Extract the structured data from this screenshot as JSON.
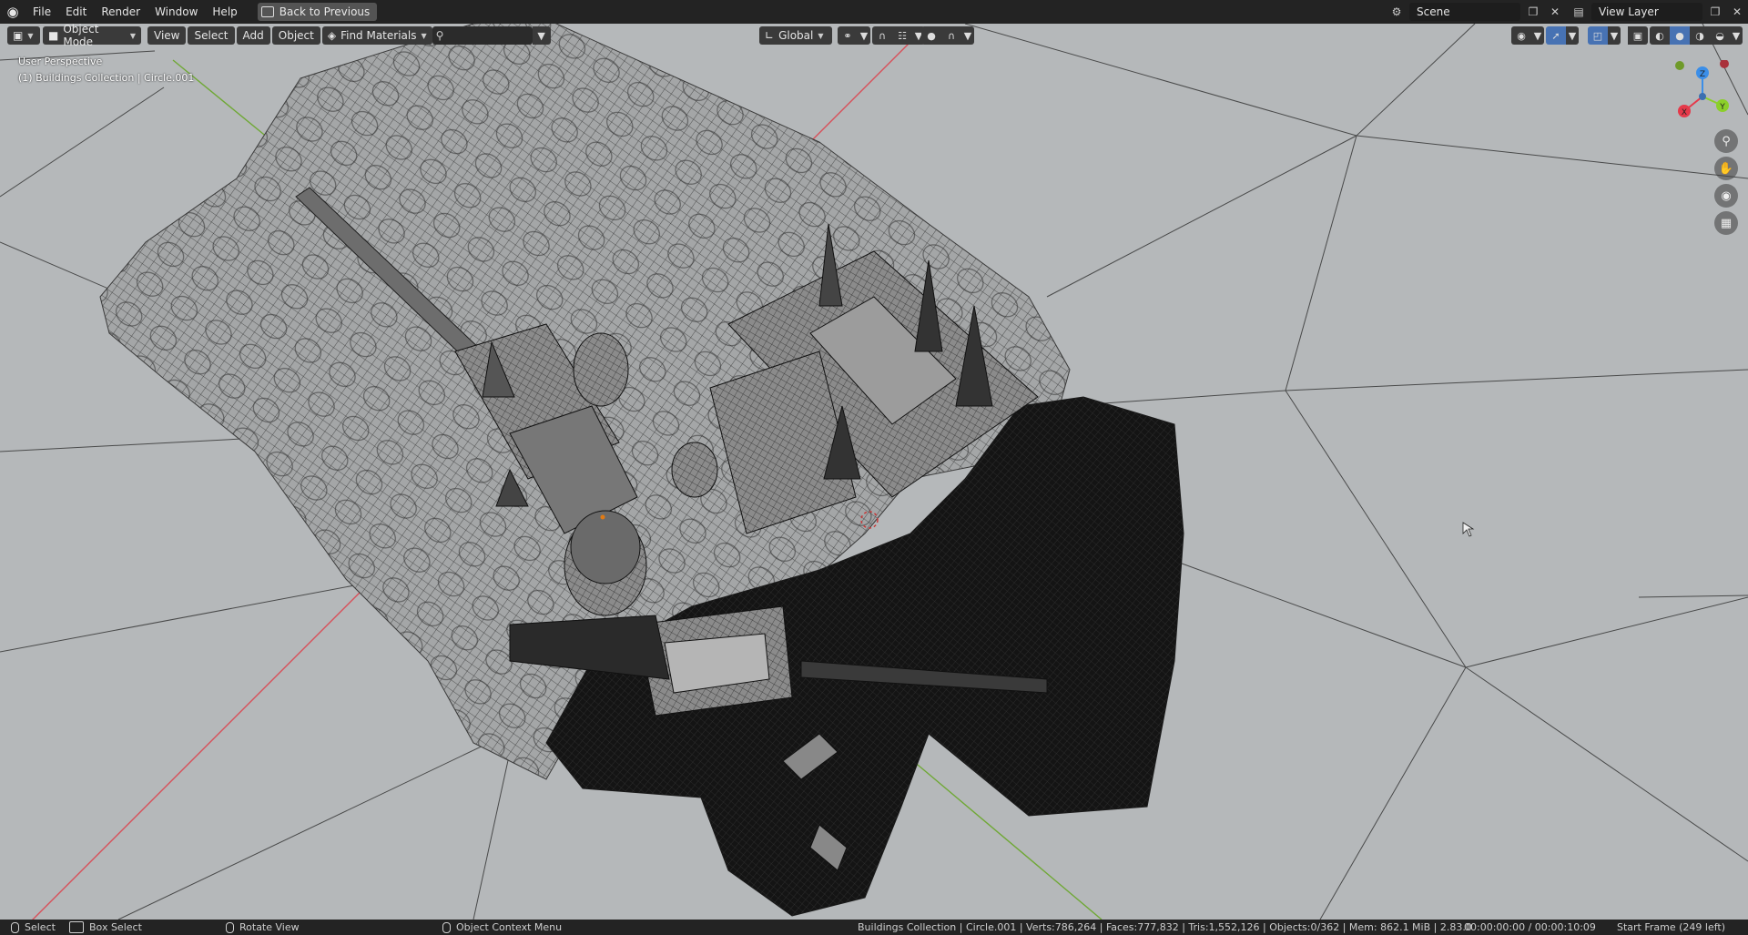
{
  "menu": {
    "items": [
      "File",
      "Edit",
      "Render",
      "Window",
      "Help"
    ],
    "back_button": "Back to Previous"
  },
  "topright": {
    "scene": "Scene",
    "view_layer": "View Layer"
  },
  "viewport_header": {
    "mode": "Object Mode",
    "view": "View",
    "select": "Select",
    "add": "Add",
    "object": "Object",
    "find_materials": "Find Materials",
    "transform_orientation": "Global"
  },
  "viewport": {
    "perspective": "User Perspective",
    "collection_info": "(1) Buildings Collection | Circle.001"
  },
  "gizmo": {
    "x": "X",
    "y": "Y",
    "z": "Z",
    "colors": {
      "x": "#e5394a",
      "y": "#8bcf2a",
      "z": "#3b8ee8"
    }
  },
  "statusbar": {
    "select": "Select",
    "box_select": "Box Select",
    "rotate_view": "Rotate View",
    "context_menu": "Object Context Menu",
    "stats": "Buildings Collection | Circle.001 | Verts:786,264 | Faces:777,832 | Tris:1,552,126 | Objects:0/362 | Mem: 862.1 MiB | 2.83.0",
    "timecode": "00:00:00:00 / 00:00:10:09",
    "start_frame": "Start Frame (249 left)"
  },
  "icons": [
    "blender-logo-icon",
    "back-icon",
    "scene-icon",
    "new-scene-icon",
    "close-icon",
    "view-layer-icon",
    "editor-type-icon",
    "object-mode-icon",
    "search-icon",
    "transform-icon",
    "pivot-icon",
    "snap-icon",
    "proportional-icon",
    "visibility-icon",
    "gizmo-icon",
    "overlay-icon",
    "xray-icon",
    "wireframe-shading-icon",
    "solid-shading-icon",
    "material-shading-icon",
    "rendered-shading-icon",
    "zoom-icon",
    "hand-icon",
    "camera-icon",
    "grid-icon"
  ]
}
